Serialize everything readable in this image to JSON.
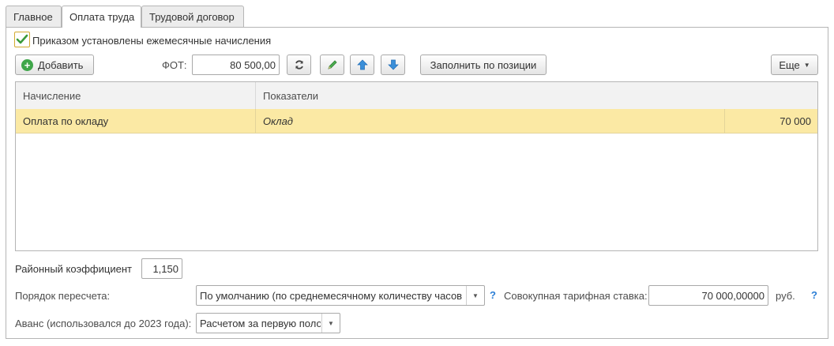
{
  "tabs": [
    {
      "label": "Главное"
    },
    {
      "label": "Оплата труда"
    },
    {
      "label": "Трудовой договор"
    }
  ],
  "order_checkbox": {
    "label": "Приказом установлены ежемесячные начисления",
    "checked": true
  },
  "toolbar": {
    "add_label": "Добавить",
    "fot_label": "ФОТ:",
    "fot_value": "80 500,00",
    "refresh_icon": "refresh-icon",
    "edit_icon": "pencil-icon",
    "up_icon": "arrow-up-icon",
    "down_icon": "arrow-down-icon",
    "fill_by_position_label": "Заполнить по позиции",
    "more_label": "Еще"
  },
  "table": {
    "columns": [
      "Начисление",
      "Показатели"
    ],
    "rows": [
      {
        "accrual": "Оплата по окладу",
        "indicator": "Оклад",
        "value": "70 000"
      }
    ]
  },
  "district_coef": {
    "label": "Районный коэффициент",
    "value": "1,150"
  },
  "recalc_order": {
    "label": "Порядок пересчета:",
    "value": "По умолчанию (по среднемесячному количеству часов"
  },
  "tariff_rate": {
    "label": "Совокупная тарифная ставка:",
    "value": "70 000,00000",
    "unit": "руб."
  },
  "advance": {
    "label": "Аванс (использовался до 2023 года):",
    "value": "Расчетом за первую поло"
  },
  "help_mark": "?",
  "colors": {
    "selected_row": "#fbe9a4",
    "accent_green": "#3fa64a",
    "accent_blue": "#3a8fd9"
  }
}
